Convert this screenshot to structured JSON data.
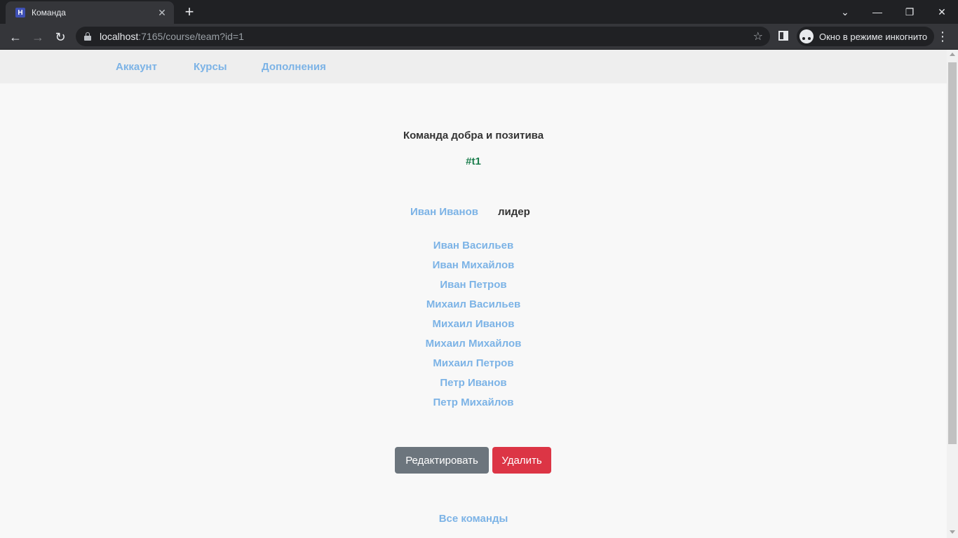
{
  "browser": {
    "tab_title": "Команда",
    "favicon_letter": "H",
    "url_host": "localhost",
    "url_path": ":7165/course/team?id=1",
    "incognito_label": "Окно в режиме инкогнито"
  },
  "nav": {
    "items": [
      {
        "label": "Аккаунт"
      },
      {
        "label": "Курсы"
      },
      {
        "label": "Дополнения"
      }
    ]
  },
  "team": {
    "name": "Команда добра и позитива",
    "tag": "#t1",
    "leader": {
      "name": "Иван Иванов",
      "role": "лидер"
    },
    "members": [
      "Иван Васильев",
      "Иван Михайлов",
      "Иван Петров",
      "Михаил Васильев",
      "Михаил Иванов",
      "Михаил Михайлов",
      "Михаил Петров",
      "Петр Иванов",
      "Петр Михайлов"
    ]
  },
  "actions": {
    "edit_label": "Редактировать",
    "delete_label": "Удалить",
    "all_teams_label": "Все команды"
  },
  "colors": {
    "link": "#7cb3e6",
    "tag": "#1e7f4f",
    "edit_button": "#6c757d",
    "delete_button": "#dc3545"
  }
}
